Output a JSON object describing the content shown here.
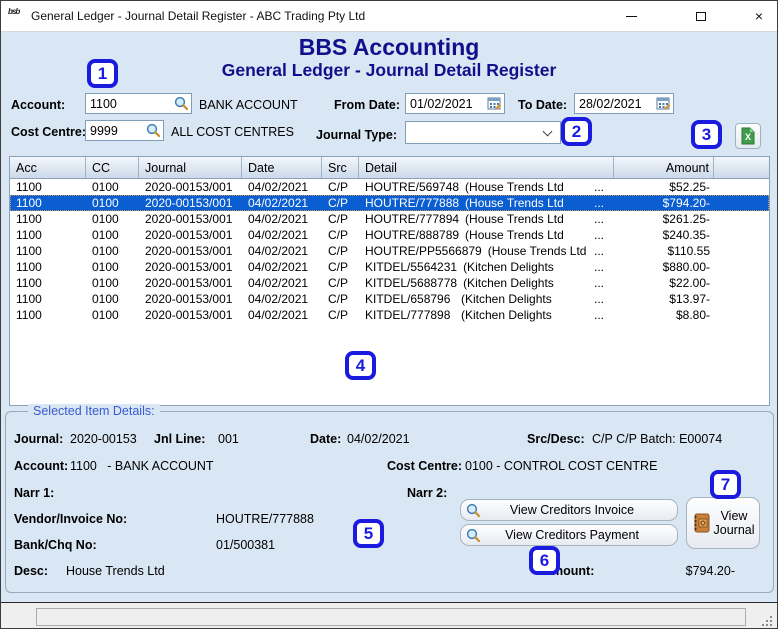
{
  "colors": {
    "accent_navy": "#10108c",
    "annotation_blue": "#1b1be0",
    "selected_row_blue": "#0a5ed2",
    "window_bg": "#d9e6f3"
  },
  "window": {
    "title": "General Ledger - Journal Detail Register - ABC Trading Pty Ltd",
    "app_icon_text": "bsb",
    "close_glyph": "×"
  },
  "header": {
    "app_title": "BBS Accounting",
    "screen_title": "General Ledger - Journal Detail Register"
  },
  "filters": {
    "account": {
      "label": "Account:",
      "value": "1100",
      "desc": "BANK ACCOUNT"
    },
    "cost_centre": {
      "label": "Cost Centre:",
      "value": "9999",
      "desc": "ALL COST CENTRES"
    },
    "from_date": {
      "label": "From Date:",
      "value": "01/02/2021"
    },
    "to_date": {
      "label": "To Date:",
      "value": "28/02/2021"
    },
    "journal_type": {
      "label": "Journal Type:",
      "value": ""
    }
  },
  "table": {
    "columns": {
      "acc": "Acc",
      "cc": "CC",
      "journal": "Journal",
      "date": "Date",
      "src": "Src",
      "detail": "Detail",
      "amount": "Amount"
    },
    "ellipsis": "...",
    "rows": [
      {
        "acc": "1100",
        "cc": "0100",
        "journal": "2020-00153/001",
        "date": "04/02/2021",
        "src": "C/P",
        "ref": "HOUTRE/569748",
        "name": "(House Trends Ltd",
        "amount": "$52.25-",
        "selected": false
      },
      {
        "acc": "1100",
        "cc": "0100",
        "journal": "2020-00153/001",
        "date": "04/02/2021",
        "src": "C/P",
        "ref": "HOUTRE/777888",
        "name": "(House Trends Ltd",
        "amount": "$794.20-",
        "selected": true
      },
      {
        "acc": "1100",
        "cc": "0100",
        "journal": "2020-00153/001",
        "date": "04/02/2021",
        "src": "C/P",
        "ref": "HOUTRE/777894",
        "name": "(House Trends Ltd",
        "amount": "$261.25-",
        "selected": false
      },
      {
        "acc": "1100",
        "cc": "0100",
        "journal": "2020-00153/001",
        "date": "04/02/2021",
        "src": "C/P",
        "ref": "HOUTRE/888789",
        "name": "(House Trends Ltd",
        "amount": "$240.35-",
        "selected": false
      },
      {
        "acc": "1100",
        "cc": "0100",
        "journal": "2020-00153/001",
        "date": "04/02/2021",
        "src": "C/P",
        "ref": "HOUTRE/PP5566879",
        "name": "(House Trends Ltd",
        "amount": "$110.55",
        "selected": false
      },
      {
        "acc": "1100",
        "cc": "0100",
        "journal": "2020-00153/001",
        "date": "04/02/2021",
        "src": "C/P",
        "ref": "KITDEL/5564231",
        "name": "(Kitchen Delights",
        "amount": "$880.00-",
        "selected": false
      },
      {
        "acc": "1100",
        "cc": "0100",
        "journal": "2020-00153/001",
        "date": "04/02/2021",
        "src": "C/P",
        "ref": "KITDEL/5688778",
        "name": "(Kitchen Delights",
        "amount": "$22.00-",
        "selected": false
      },
      {
        "acc": "1100",
        "cc": "0100",
        "journal": "2020-00153/001",
        "date": "04/02/2021",
        "src": "C/P",
        "ref": "KITDEL/658796",
        "name": "(Kitchen Delights",
        "amount": "$13.97-",
        "selected": false
      },
      {
        "acc": "1100",
        "cc": "0100",
        "journal": "2020-00153/001",
        "date": "04/02/2021",
        "src": "C/P",
        "ref": "KITDEL/777898",
        "name": "(Kitchen Delights",
        "amount": "$8.80-",
        "selected": false
      }
    ]
  },
  "details": {
    "group_title": "Selected Item Details:",
    "journal_label": "Journal:",
    "journal_value": "2020-00153",
    "jnl_line_label": "Jnl Line:",
    "jnl_line_value": "001",
    "date_label": "Date:",
    "date_value": "04/02/2021",
    "src_desc_label": "Src/Desc:",
    "src_desc_value": "C/P C/P Batch: E00074",
    "account_label": "Account:",
    "account_value": "1100   - BANK ACCOUNT",
    "cost_centre_label": "Cost Centre:",
    "cost_centre_value": "0100 - CONTROL COST CENTRE",
    "narr1_label": "Narr 1:",
    "narr2_label": "Narr 2:",
    "vendor_label": "Vendor/Invoice No:",
    "vendor_value": "HOUTRE/777888",
    "bank_label": "Bank/Chq No:",
    "bank_value": "01/500381",
    "desc_label": "Desc:",
    "desc_value": "House Trends Ltd",
    "amount_label": "Amount:",
    "amount_value": "$794.20-"
  },
  "buttons": {
    "view_invoice": "View Creditors Invoice",
    "view_payment": "View Creditors Payment",
    "view_journal_line1": "View",
    "view_journal_line2": "Journal"
  },
  "annotations": {
    "n1": "1",
    "n2": "2",
    "n3": "3",
    "n4": "4",
    "n5": "5",
    "n6": "6",
    "n7": "7"
  }
}
